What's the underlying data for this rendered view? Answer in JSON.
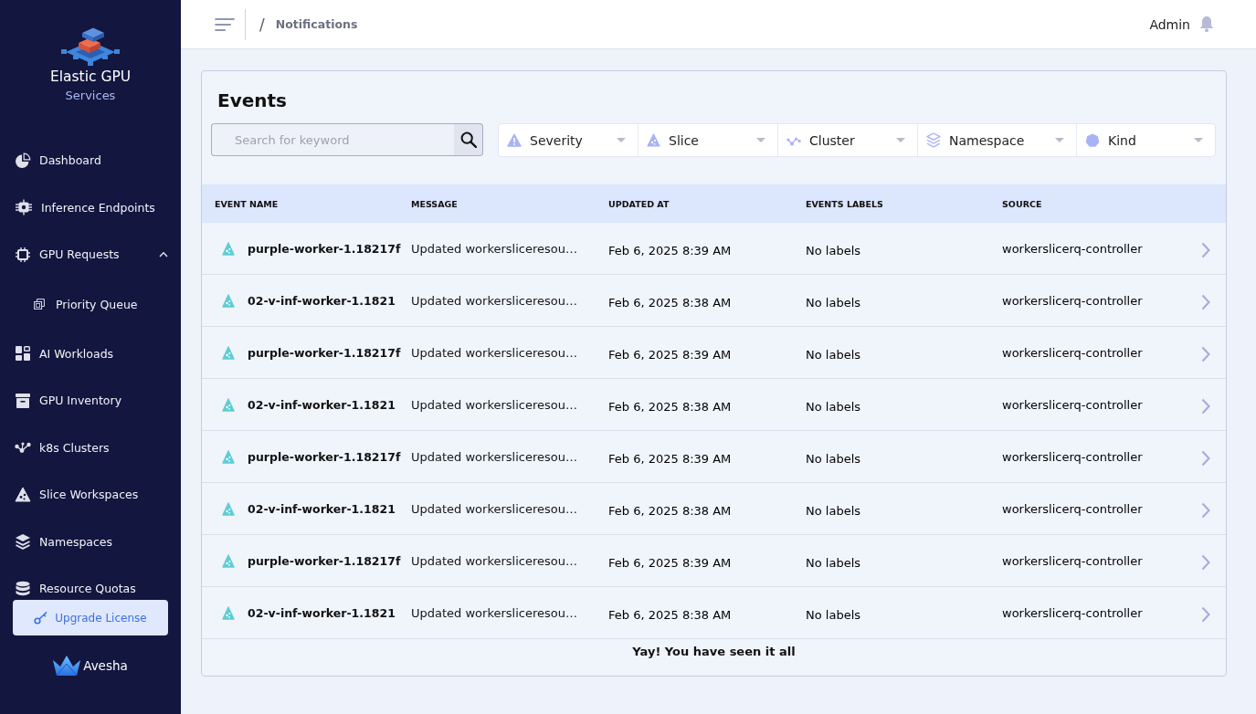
{
  "sidebar": {
    "brand": {
      "title": "Elastic GPU",
      "subtitle": "Services"
    },
    "items": [
      {
        "label": "Dashboard"
      },
      {
        "label": "Inference Endpoints"
      },
      {
        "label": "GPU Requests",
        "expanded": true,
        "children": [
          {
            "label": "Priority Queue"
          }
        ]
      },
      {
        "label": "AI Workloads"
      },
      {
        "label": "GPU Inventory"
      },
      {
        "label": "k8s Clusters"
      },
      {
        "label": "Slice Workspaces"
      },
      {
        "label": "Namespaces"
      },
      {
        "label": "Resource Quotas"
      }
    ],
    "upgrade_button": "Upgrade License",
    "company": "Avesha"
  },
  "header": {
    "breadcrumb_separator": "/",
    "breadcrumb": "Notifications",
    "user": "Admin"
  },
  "events": {
    "title": "Events",
    "search": {
      "placeholder": "Search for keyword"
    },
    "filters": [
      {
        "label": "Severity"
      },
      {
        "label": "Slice"
      },
      {
        "label": "Cluster"
      },
      {
        "label": "Namespace"
      },
      {
        "label": "Kind"
      }
    ],
    "table": {
      "columns": [
        "EVENT NAME",
        "MESSAGE",
        "UPDATED AT",
        "EVENTS LABELS",
        "SOURCE"
      ],
      "rows": [
        {
          "event_name": "purple-worker-1.18217f",
          "message": "Updated workersliceresou…",
          "updated_at": "Feb 6, 2025 8:39 AM",
          "labels": "No labels",
          "source": "workerslicerq-controller"
        },
        {
          "event_name": "02-v-inf-worker-1.1821",
          "message": "Updated workersliceresou…",
          "updated_at": "Feb 6, 2025 8:38 AM",
          "labels": "No labels",
          "source": "workerslicerq-controller"
        },
        {
          "event_name": "purple-worker-1.18217f",
          "message": "Updated workersliceresou…",
          "updated_at": "Feb 6, 2025 8:39 AM",
          "labels": "No labels",
          "source": "workerslicerq-controller"
        },
        {
          "event_name": "02-v-inf-worker-1.1821",
          "message": "Updated workersliceresou…",
          "updated_at": "Feb 6, 2025 8:38 AM",
          "labels": "No labels",
          "source": "workerslicerq-controller"
        },
        {
          "event_name": "purple-worker-1.18217f",
          "message": "Updated workersliceresou…",
          "updated_at": "Feb 6, 2025 8:39 AM",
          "labels": "No labels",
          "source": "workerslicerq-controller"
        },
        {
          "event_name": "02-v-inf-worker-1.1821",
          "message": "Updated workersliceresou…",
          "updated_at": "Feb 6, 2025 8:38 AM",
          "labels": "No labels",
          "source": "workerslicerq-controller"
        },
        {
          "event_name": "purple-worker-1.18217f",
          "message": "Updated workersliceresou…",
          "updated_at": "Feb 6, 2025 8:39 AM",
          "labels": "No labels",
          "source": "workerslicerq-controller"
        },
        {
          "event_name": "02-v-inf-worker-1.1821",
          "message": "Updated workersliceresou…",
          "updated_at": "Feb 6, 2025 8:38 AM",
          "labels": "No labels",
          "source": "workerslicerq-controller"
        }
      ]
    },
    "end_message": "Yay! You have seen it all"
  }
}
